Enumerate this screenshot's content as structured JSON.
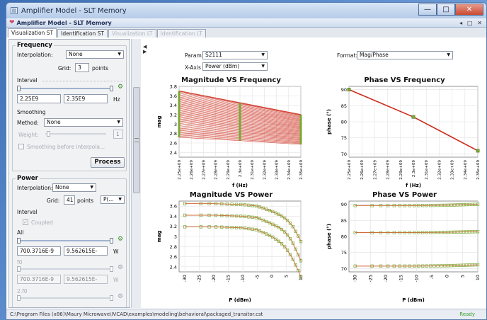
{
  "window": {
    "title": "Amplifier Model - SLT Memory",
    "inner_title": "Amplifier Model - SLT Memory",
    "inner_controls": "◂ □ ✕",
    "buttons": {
      "minimize": "—",
      "maximize": "□",
      "close": "✕"
    }
  },
  "tabs": [
    {
      "label": "Visualization ST",
      "state": "active"
    },
    {
      "label": "Identification ST",
      "state": "normal"
    },
    {
      "label": "Visualization LT",
      "state": "disabled"
    },
    {
      "label": "Identification LT",
      "state": "disabled"
    }
  ],
  "frequency": {
    "title": "Frequency",
    "interp_label": "Interpolation:",
    "interp_value": "None",
    "grid_label": "Grid:",
    "grid_value": "3",
    "grid_unit": "points",
    "interval_label": "Interval",
    "min": "2.25E9",
    "max": "2.35E9",
    "unit": "Hz",
    "smoothing_label": "Smoothing",
    "method_label": "Method:",
    "method_value": "None",
    "weight_label": "Weight:",
    "weight_value": "1",
    "smooth_before_label": "Smoothing before interpola...",
    "process_label": "Process"
  },
  "power": {
    "title": "Power",
    "interp_label": "Interpolation:",
    "interp_value": "None",
    "grid_label": "Grid:",
    "grid_value": "41",
    "grid_unit": "points",
    "grid_type": "P(...",
    "interval_label": "Interval",
    "coupled_label": "Coupled",
    "all_label": "All",
    "all_min": "700.3716E-9",
    "all_max": "9.562615E-",
    "unit": "W",
    "f0_label": "f0",
    "f0_min": "700.3716E-9",
    "f0_max": "9.562615E-",
    "f0_unit": "W",
    "f2_label": "2.f0"
  },
  "controls": {
    "param_label": "Param:",
    "param_value": "S2111",
    "xaxis_label": "X-Axis",
    "xaxis_value": "Power (dBm)",
    "format_label": "Format:",
    "format_value": "Mag/Phase"
  },
  "plots": [
    {
      "title": "Magnitude VS Frequency",
      "ylabel": "mag",
      "xlabel": "f (Hz)",
      "yticks": [
        "3.8",
        "3.6",
        "3.4",
        "3.2",
        "3",
        "2.8",
        "2.6",
        "2.4"
      ],
      "xticks": [
        "2.25e+09",
        "2.26e+09",
        "2.27e+09",
        "2.28e+09",
        "2.29e+09",
        "2.3e+09",
        "2.31e+09",
        "2.32e+09",
        "2.33e+09",
        "2.34e+09",
        "2.35e+09"
      ]
    },
    {
      "title": "Phase VS Frequency",
      "ylabel": "phase (°)",
      "xlabel": "f (Hz)",
      "yticks": [
        "90",
        "85",
        "80",
        "75",
        "70"
      ],
      "xticks": [
        "2.25e+09",
        "2.26e+09",
        "2.27e+09",
        "2.28e+09",
        "2.29e+09",
        "2.3e+09",
        "2.31e+09",
        "2.32e+09",
        "2.33e+09",
        "2.34e+09",
        "2.35e+09"
      ]
    },
    {
      "title": "Magnitude VS Power",
      "ylabel": "mag",
      "xlabel": "P (dBm)",
      "yticks": [
        "3.6",
        "3.4",
        "3.2",
        "3",
        "2.8",
        "2.6",
        "2.4"
      ],
      "xticks": [
        "-30",
        "-25",
        "-20",
        "-15",
        "-10",
        "-5",
        "0",
        "5",
        "10"
      ]
    },
    {
      "title": "Phase VS Power",
      "ylabel": "phase (°)",
      "xlabel": "P (dBm)",
      "yticks": [
        "90",
        "85",
        "80",
        "75",
        "70"
      ],
      "xticks": [
        "-30",
        "-25",
        "-20",
        "-15",
        "-10",
        "-5",
        "0",
        "5",
        "10"
      ]
    }
  ],
  "chart_data": [
    {
      "type": "line",
      "title": "Magnitude VS Frequency",
      "xlabel": "f (Hz)",
      "ylabel": "mag",
      "xlim": [
        2250000000.0,
        2350000000.0
      ],
      "ylim": [
        2.3,
        3.8
      ],
      "x": [
        2250000000.0,
        2300000000.0,
        2350000000.0
      ],
      "series_count": 41,
      "series_top": [
        3.7,
        3.45,
        3.2
      ],
      "series_bottom": [
        2.72,
        2.65,
        2.57
      ]
    },
    {
      "type": "line",
      "title": "Phase VS Frequency",
      "xlabel": "f (Hz)",
      "ylabel": "phase (°)",
      "xlim": [
        2250000000.0,
        2350000000.0
      ],
      "ylim": [
        69,
        91
      ],
      "x": [
        2250000000.0,
        2300000000.0,
        2350000000.0
      ],
      "values": [
        90,
        81.5,
        71
      ]
    },
    {
      "type": "line",
      "title": "Magnitude VS Power",
      "xlabel": "P (dBm)",
      "ylabel": "mag",
      "xlim": [
        -32,
        10
      ],
      "ylim": [
        2.3,
        3.7
      ],
      "x": [
        -30,
        -20,
        -10,
        -5,
        0,
        3,
        5,
        7,
        9,
        10
      ],
      "series": [
        {
          "values": [
            3.65,
            3.65,
            3.63,
            3.6,
            3.5,
            3.42,
            3.34,
            3.22,
            3.02,
            2.9
          ]
        },
        {
          "values": [
            3.42,
            3.42,
            3.4,
            3.37,
            3.25,
            3.16,
            3.06,
            2.9,
            2.65,
            2.52
          ]
        },
        {
          "values": [
            3.19,
            3.19,
            3.17,
            3.13,
            3.0,
            2.88,
            2.76,
            2.58,
            2.34,
            2.2
          ]
        }
      ]
    },
    {
      "type": "line",
      "title": "Phase VS Power",
      "xlabel": "P (dBm)",
      "ylabel": "phase (°)",
      "xlim": [
        -32,
        10
      ],
      "ylim": [
        69,
        91
      ],
      "x": [
        -30,
        -20,
        -10,
        0,
        10
      ],
      "series": [
        {
          "values": [
            89.6,
            89.6,
            89.6,
            89.7,
            90.0
          ]
        },
        {
          "values": [
            81.2,
            81.2,
            81.2,
            81.3,
            81.5
          ]
        },
        {
          "values": [
            70.8,
            70.8,
            70.8,
            70.9,
            71.2
          ]
        }
      ]
    }
  ],
  "colors": {
    "curve_red": "#cc2a1a",
    "marker_green": "#7aa834",
    "curve_orange": "#d4693a"
  },
  "status": {
    "path": "C:\\Program Files (x86)\\Maury Microwave\\IVCAD\\examples\\modeling\\behavioral\\packaged_transitor.cst",
    "state": "Ready"
  }
}
